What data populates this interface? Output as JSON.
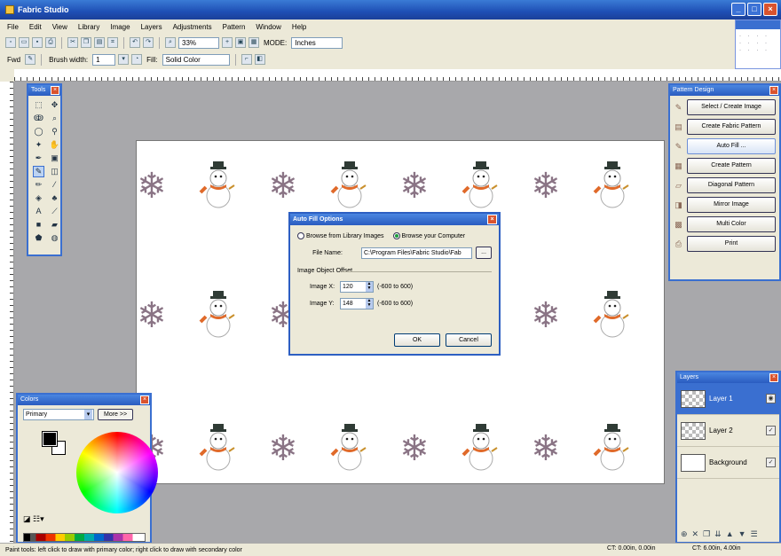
{
  "window": {
    "title": "Fabric Studio"
  },
  "menu": [
    "File",
    "Edit",
    "View",
    "Library",
    "Image",
    "Layers",
    "Adjustments",
    "Pattern",
    "Window",
    "Help"
  ],
  "toolbar1": {
    "zoom": "33%",
    "mode_label": "MODE:",
    "mode_value": "Inches"
  },
  "toolbar2": {
    "tool_label": "Fwd",
    "brush_label": "Brush width:",
    "brush_value": "1",
    "fill_label": "Fill:",
    "fill_value": "Solid Color"
  },
  "palettes": {
    "tools": {
      "title": "Tools"
    },
    "colors": {
      "title": "Colors",
      "mode": "Primary",
      "more_button": "More >>"
    },
    "actions": {
      "title": "Pattern Design",
      "buttons": [
        "Select / Create Image",
        "Create Fabric Pattern",
        "Auto Fill ...",
        "Create Pattern",
        "Diagonal Pattern",
        "Mirror Image",
        "Multi Color",
        "Print"
      ]
    },
    "layers": {
      "title": "Layers",
      "items": [
        "Layer 1",
        "Layer 2",
        "Background"
      ]
    }
  },
  "dialog": {
    "title": "Auto Fill Options",
    "option_library": "Browse from Library Images",
    "option_computer": "Browse your Computer",
    "file_name_label": "File Name:",
    "file_path": "C:\\Program Files\\Fabric Studio\\Fab",
    "browse_label": "...",
    "group_label": "Image Object Offset",
    "offset_x_label": "Image X:",
    "offset_x_value": "120",
    "offset_x_range": "(-600 to 600)",
    "offset_y_label": "Image Y:",
    "offset_y_value": "148",
    "offset_y_range": "(-600 to 600)",
    "ok": "OK",
    "cancel": "Cancel"
  },
  "status": {
    "hint": "Paint tools: left click to draw with primary color; right click to draw with secondary color",
    "coords": "CT: 0.00in, 0.00in",
    "size": "CT: 6.00in, 4.00in"
  }
}
